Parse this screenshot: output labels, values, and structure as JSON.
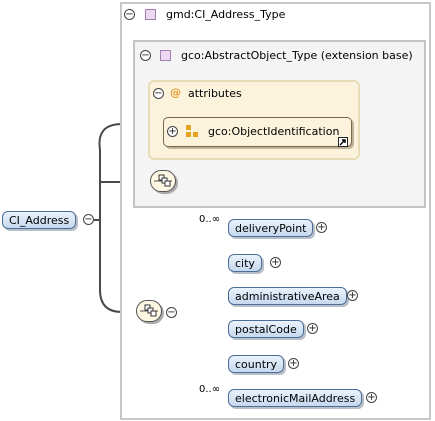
{
  "root_element": {
    "label": "CI_Address"
  },
  "complex_type": {
    "label": "gmd:CI_Address_Type"
  },
  "extension": {
    "label": "gco:AbstractObject_Type (extension base)"
  },
  "attributes": {
    "label": "attributes",
    "symbol": "@",
    "group_ref": {
      "label": "gco:ObjectIdentification"
    }
  },
  "sequence": {
    "elements": [
      {
        "label": "deliveryPoint",
        "occurrence": "0..∞"
      },
      {
        "label": "city",
        "occurrence": ""
      },
      {
        "label": "administrativeArea",
        "occurrence": ""
      },
      {
        "label": "postalCode",
        "occurrence": ""
      },
      {
        "label": "country",
        "occurrence": ""
      },
      {
        "label": "electronicMailAddress",
        "occurrence": "0..∞"
      }
    ]
  },
  "icons": {
    "collapse": "minus-toggle-icon",
    "expand": "plus-toggle-icon",
    "type": "complex-type-icon",
    "attribute_group": "attribute-group-icon",
    "reference": "reference-arrow-icon",
    "sequence": "sequence-compositor-icon"
  },
  "colors": {
    "element_fill": "#c6d9ef",
    "element_border": "#4c6d96",
    "attribute_fill": "#fbf3dc",
    "type_square": "#ecd8f2",
    "attribute_symbol": "#e89b2a"
  }
}
